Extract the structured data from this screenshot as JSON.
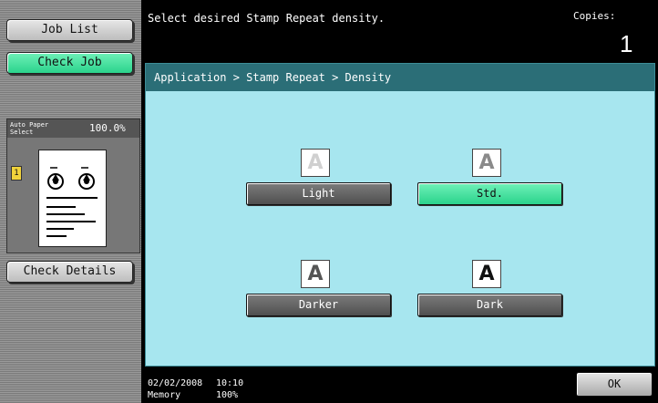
{
  "left_panel": {
    "job_list_label": "Job List",
    "check_job_label": "Check Job",
    "preview": {
      "paper_label": "Auto Paper Select",
      "zoom": "100.0%",
      "copy_icon_text": "1"
    },
    "check_details_label": "Check Details"
  },
  "header": {
    "message": "Select desired Stamp Repeat density.",
    "copies_label": "Copies:",
    "copies_value": "1"
  },
  "main": {
    "breadcrumb": "Application > Stamp Repeat > Density",
    "icon_glyph": "A",
    "options": [
      {
        "label": "Light",
        "selected": false,
        "icon_color": "#d0d0d0"
      },
      {
        "label": "Std.",
        "selected": true,
        "icon_color": "#8a8a8a"
      },
      {
        "label": "Darker",
        "selected": false,
        "icon_color": "#555555"
      },
      {
        "label": "Dark",
        "selected": false,
        "icon_color": "#111111"
      }
    ]
  },
  "footer": {
    "date": "02/02/2008",
    "time": "10:10",
    "memory_label": "Memory",
    "memory_value": "100%",
    "ok_label": "OK"
  },
  "colors": {
    "accent_green": "#2bd38c",
    "panel_bg": "#a7e6ef",
    "breadcrumb_bg": "#2b6e77"
  }
}
